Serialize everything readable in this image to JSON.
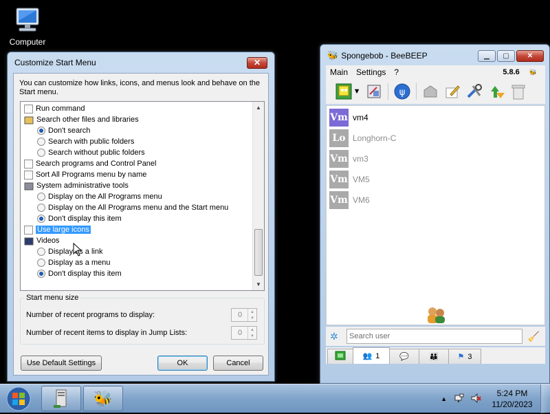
{
  "desktop": {
    "icons": [
      {
        "label": "Computer",
        "icon": "computer-icon"
      }
    ]
  },
  "customize_dialog": {
    "title": "Customize Start Menu",
    "intro": "You can customize how links, icons, and menus look and behave on the Start menu.",
    "items": [
      {
        "type": "checkbox",
        "label": "Run command",
        "checked": false
      },
      {
        "type": "group",
        "label": "Search other files and libraries",
        "icon": "search-folder-icon"
      },
      {
        "type": "radio",
        "label": "Don't search",
        "checked": true
      },
      {
        "type": "radio",
        "label": "Search with public folders",
        "checked": false
      },
      {
        "type": "radio",
        "label": "Search without public folders",
        "checked": false
      },
      {
        "type": "checkbox",
        "label": "Search programs and Control Panel",
        "checked": false
      },
      {
        "type": "checkbox",
        "label": "Sort All Programs menu by name",
        "checked": false
      },
      {
        "type": "group",
        "label": "System administrative tools",
        "icon": "admin-tools-icon"
      },
      {
        "type": "radio",
        "label": "Display on the All Programs menu",
        "checked": false
      },
      {
        "type": "radio",
        "label": "Display on the All Programs menu and the Start menu",
        "checked": false
      },
      {
        "type": "radio",
        "label": "Don't display this item",
        "checked": true
      },
      {
        "type": "checkbox",
        "label": "Use large icons",
        "checked": false,
        "selected": true
      },
      {
        "type": "group",
        "label": "Videos",
        "icon": "videos-icon"
      },
      {
        "type": "radio",
        "label": "Display as a link",
        "checked": false
      },
      {
        "type": "radio",
        "label": "Display as a menu",
        "checked": false
      },
      {
        "type": "radio",
        "label": "Don't display this item",
        "checked": true
      }
    ],
    "size_group": {
      "label": "Start menu size",
      "recent_programs_label": "Number of recent programs to display:",
      "recent_programs_value": "0",
      "recent_items_label": "Number of recent items to display in Jump Lists:",
      "recent_items_value": "0"
    },
    "buttons": {
      "default": "Use Default Settings",
      "ok": "OK",
      "cancel": "Cancel"
    },
    "close_glyph": "✕"
  },
  "beebeep": {
    "title": "Spongebob - BeeBEEP",
    "menu": [
      "Main",
      "Settings",
      "?"
    ],
    "version": "5.8.6",
    "window_buttons": {
      "minimize": "▁",
      "maximize": "▢",
      "close": "✕"
    },
    "users": [
      {
        "avatar": "Vm",
        "name": "vm4",
        "online": true,
        "color": "#7c6ad6"
      },
      {
        "avatar": "Lo",
        "name": "Longhorn-C",
        "online": false,
        "color": "#a9a9a9"
      },
      {
        "avatar": "Vm",
        "name": "vm3",
        "online": false,
        "color": "#a9a9a9"
      },
      {
        "avatar": "Vm",
        "name": "VM5",
        "online": false,
        "color": "#a9a9a9"
      },
      {
        "avatar": "Vm",
        "name": "VM6",
        "online": false,
        "color": "#a9a9a9"
      }
    ],
    "search_placeholder": "Search user",
    "tabs": [
      {
        "icon": "home-icon",
        "count": ""
      },
      {
        "icon": "users-icon",
        "count": "1"
      },
      {
        "icon": "chat-icon",
        "count": ""
      },
      {
        "icon": "groups-icon",
        "count": ""
      },
      {
        "icon": "flag-icon",
        "count": "3"
      }
    ]
  },
  "taskbar": {
    "time": "5:24 PM",
    "date": "11/20/2023",
    "tray_arrow": "▲"
  }
}
